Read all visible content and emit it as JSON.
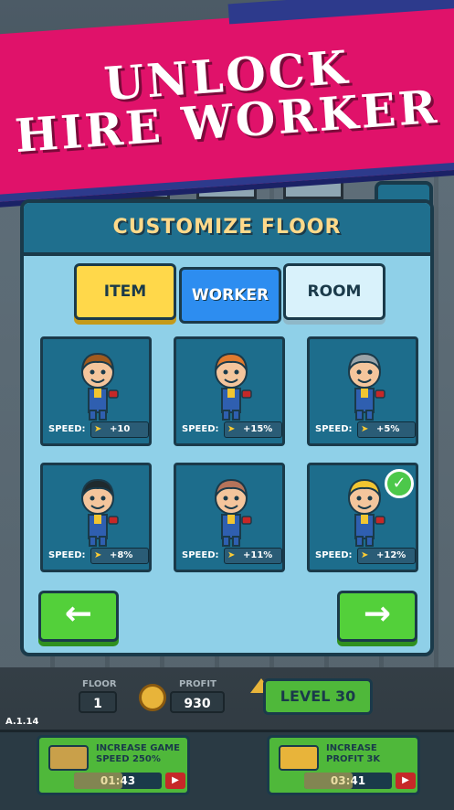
{
  "banner": {
    "line1": "UNLOCK",
    "line2": "HIRE WORKER"
  },
  "panel": {
    "title": "CUSTOMIZE FLOOR",
    "tabs": {
      "item": "ITEM",
      "worker": "WORKER",
      "room": "ROOM"
    },
    "selected_tab": "WORKER"
  },
  "workers": [
    {
      "speed_label": "SPEED:",
      "speed_value": "+10",
      "hair_color": "#a05a1e",
      "selected": false
    },
    {
      "speed_label": "SPEED:",
      "speed_value": "+15%",
      "hair_color": "#e07a2e",
      "selected": false
    },
    {
      "speed_label": "SPEED:",
      "speed_value": "+5%",
      "hair_color": "#9aa3a8",
      "selected": false
    },
    {
      "speed_label": "SPEED:",
      "speed_value": "+8%",
      "hair_color": "#1f2a2e",
      "selected": false
    },
    {
      "speed_label": "SPEED:",
      "speed_value": "+11%",
      "hair_color": "#b5735a",
      "selected": false
    },
    {
      "speed_label": "SPEED:",
      "speed_value": "+12%",
      "hair_color": "#f2c531",
      "selected": true
    }
  ],
  "nav": {
    "prev_icon": "arrow-left-icon",
    "next_icon": "arrow-right-icon"
  },
  "hud": {
    "floor_label": "FLOOR",
    "floor_value": "1",
    "profit_label": "PROFIT",
    "profit_value": "930",
    "level_label": "LEVEL 30",
    "version": "A.1.14"
  },
  "boosts": [
    {
      "title": "INCREASE GAME SPEED 250%",
      "timer": "01:43",
      "progress": 0.55
    },
    {
      "title": "INCREASE PROFIT 3K",
      "timer": "03:41",
      "progress": 0.55
    }
  ],
  "colors": {
    "banner": "#e0126a",
    "panel": "#8fd0e8",
    "accent_green": "#53d03a",
    "tab_selected": "#2d8df0"
  }
}
